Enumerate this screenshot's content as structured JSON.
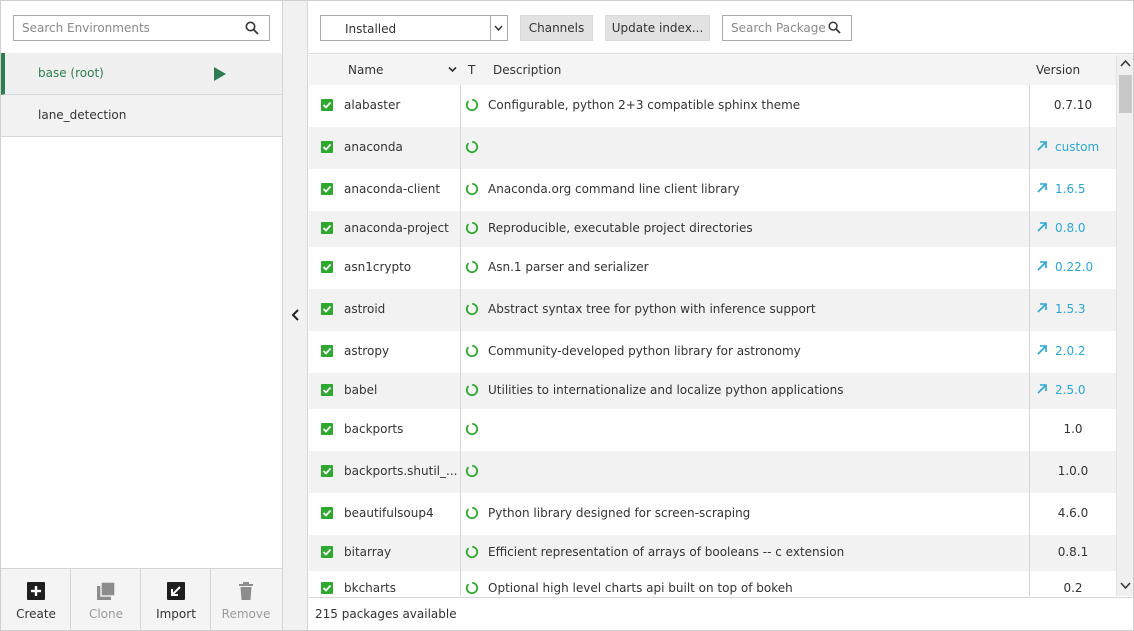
{
  "environments": {
    "search_placeholder": "Search Environments",
    "items": [
      {
        "label": "base (root)",
        "active": true
      },
      {
        "label": "lane_detection",
        "active": false
      }
    ],
    "actions": [
      {
        "label": "Create",
        "icon": "plus-square-icon",
        "enabled": true
      },
      {
        "label": "Clone",
        "icon": "clone-icon",
        "enabled": false
      },
      {
        "label": "Import",
        "icon": "import-icon",
        "enabled": true
      },
      {
        "label": "Remove",
        "icon": "trash-icon",
        "enabled": false
      }
    ]
  },
  "toolbar": {
    "filter_value": "Installed",
    "channels_label": "Channels",
    "update_index_label": "Update index...",
    "search_placeholder": "Search Packages"
  },
  "table": {
    "columns": {
      "name": "Name",
      "type": "T",
      "description": "Description",
      "version": "Version"
    },
    "rows": [
      {
        "name": "alabaster",
        "description": "Configurable, python 2+3 compatible sphinx theme",
        "version": "0.7.10",
        "update": false
      },
      {
        "name": "anaconda",
        "description": "",
        "version": "custom",
        "update": true
      },
      {
        "name": "anaconda-client",
        "description": "Anaconda.org command line client library",
        "version": "1.6.5",
        "update": true
      },
      {
        "name": "anaconda-project",
        "description": "Reproducible, executable project directories",
        "version": "0.8.0",
        "update": true
      },
      {
        "name": "asn1crypto",
        "description": "Asn.1 parser and serializer",
        "version": "0.22.0",
        "update": true
      },
      {
        "name": "astroid",
        "description": "Abstract syntax tree for python with inference support",
        "version": "1.5.3",
        "update": true
      },
      {
        "name": "astropy",
        "description": "Community-developed python library for astronomy",
        "version": "2.0.2",
        "update": true
      },
      {
        "name": "babel",
        "description": "Utilities to internationalize and localize python applications",
        "version": "2.5.0",
        "update": true
      },
      {
        "name": "backports",
        "description": "",
        "version": "1.0",
        "update": false
      },
      {
        "name": "backports.shutil_...",
        "description": "",
        "version": "1.0.0",
        "update": false
      },
      {
        "name": "beautifulsoup4",
        "description": "Python library designed for screen-scraping",
        "version": "4.6.0",
        "update": false
      },
      {
        "name": "bitarray",
        "description": "Efficient representation of arrays of booleans -- c extension",
        "version": "0.8.1",
        "update": false
      },
      {
        "name": "bkcharts",
        "description": "Optional high level charts api built on top of bokeh",
        "version": "0.2",
        "update": false
      }
    ]
  },
  "footer": {
    "count_text": "215 packages available"
  },
  "colors": {
    "accent_green": "#2e7d52",
    "check_green": "#2ea82e",
    "update_blue": "#2aa7d6"
  }
}
